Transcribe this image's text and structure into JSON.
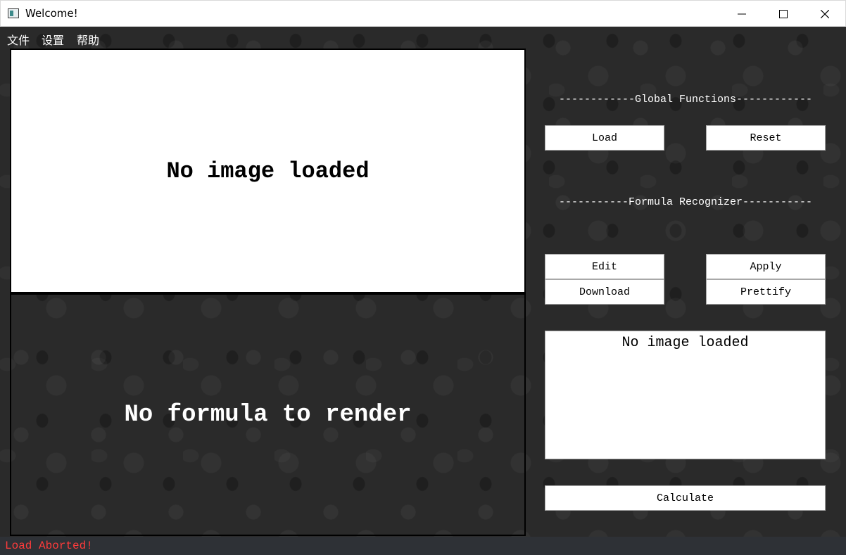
{
  "window": {
    "title": "Welcome!"
  },
  "menu": {
    "file": "文件",
    "settings": "设置",
    "help": "帮助"
  },
  "image_panel": {
    "placeholder": "No image loaded"
  },
  "render_panel": {
    "placeholder": "No formula to render"
  },
  "global_section": {
    "title": "------------Global Functions------------",
    "load_label": "Load",
    "reset_label": "Reset"
  },
  "formula_section": {
    "title": "-----------Formula Recognizer-----------",
    "edit_label": "Edit",
    "apply_label": "Apply",
    "download_label": "Download",
    "prettify_label": "Prettify",
    "result_text": "No image loaded",
    "calculate_label": "Calculate"
  },
  "status": {
    "message": "Load Aborted!",
    "color": "#ff3b3b"
  }
}
